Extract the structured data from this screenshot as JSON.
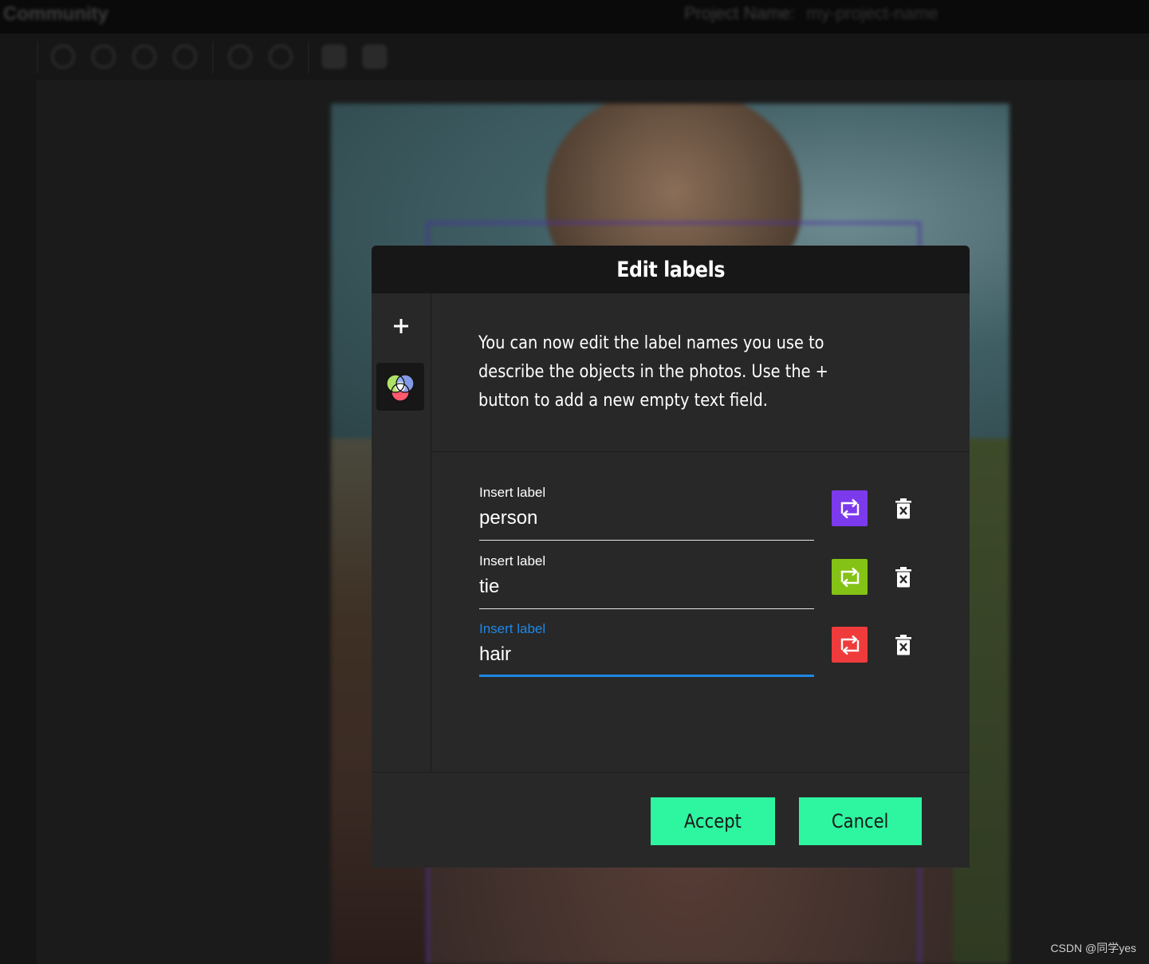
{
  "app": {
    "brand": "Community",
    "project_label": "Project Name:",
    "project_name": "my-project-name"
  },
  "toolbar": {
    "tools": [
      "zoom-in-icon",
      "zoom-out-icon",
      "zoom-fit-icon",
      "zoom-max-icon",
      "hand-icon",
      "crosshair-icon",
      "prev-image-icon",
      "next-image-icon"
    ]
  },
  "modal": {
    "title": "Edit labels",
    "description": "You can now edit the label names you use to describe the objects in the photos. Use the + button to add a new empty text field.",
    "add_icon": "plus-icon",
    "palette_icon": "palette-icon",
    "labels": [
      {
        "field_label": "Insert label",
        "value": "person",
        "color": "#7c3aed",
        "focused": false
      },
      {
        "field_label": "Insert label",
        "value": "tie",
        "color": "#84c216",
        "focused": false
      },
      {
        "field_label": "Insert label",
        "value": "hair",
        "color": "#ef3b3b",
        "focused": true
      }
    ],
    "accept_label": "Accept",
    "cancel_label": "Cancel",
    "accent_color": "#2ef5a0",
    "focus_color": "#1e88e5"
  },
  "watermark": "CSDN @同学yes"
}
